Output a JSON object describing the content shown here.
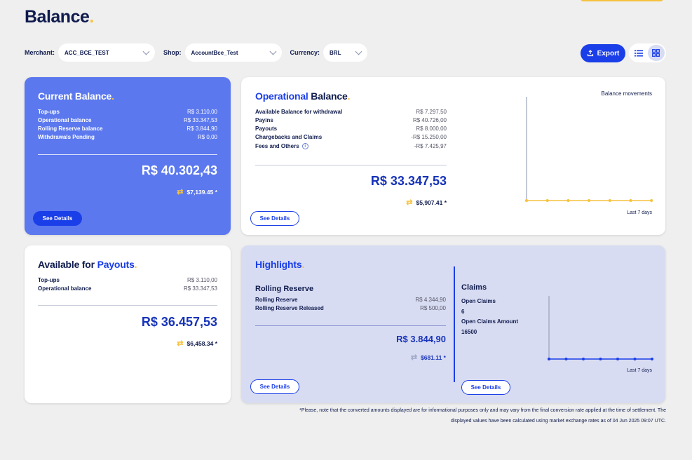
{
  "page": {
    "title": "Balance",
    "title_dot": "."
  },
  "filters": {
    "merchant_label": "Merchant:",
    "merchant_value": "ACC_BCE_TEST",
    "shop_label": "Shop:",
    "shop_value": "AccountBce_Test",
    "currency_label": "Currency:",
    "currency_value": "BRL"
  },
  "toolbar": {
    "export_label": "Export",
    "view_active": "grid"
  },
  "current_balance": {
    "title": "Current Balance",
    "rows": [
      {
        "label": "Top-ups",
        "value": "R$ 3.110,00"
      },
      {
        "label": "Operational balance",
        "value": "R$ 33.347,53"
      },
      {
        "label": "Rolling Reserve balance",
        "value": "R$ 3.844,90"
      },
      {
        "label": "Withdrawals Pending",
        "value": "R$ 0,00"
      }
    ],
    "total": "R$ 40.302,43",
    "converted": "$7,139.45 *",
    "button": "See Details"
  },
  "operational_balance": {
    "title_a": "Operational",
    "title_b": " Balance",
    "rows": [
      {
        "label": "Available Balance for withdrawal",
        "value": "R$ 7.297,50"
      },
      {
        "label": "Payins",
        "value": "R$ 40.726,00"
      },
      {
        "label": "Payouts",
        "value": "R$ 8.000,00"
      },
      {
        "label": "Chargebacks and Claims",
        "value": "-R$ 15.250,00"
      },
      {
        "label": "Fees and Others",
        "value": "-R$ 7.425,97"
      }
    ],
    "total": "R$ 33.347,53",
    "converted": "$5,907.41 *",
    "button": "See Details",
    "chart": {
      "title": "Balance movements",
      "footer": "Last 7 days"
    }
  },
  "available_payouts": {
    "title_a": "Available for ",
    "title_b": "Payouts",
    "rows": [
      {
        "label": "Top-ups",
        "value": "R$ 3.110,00"
      },
      {
        "label": "Operational balance",
        "value": "R$ 33.347,53"
      }
    ],
    "total": "R$ 36.457,53",
    "converted": "$6,458.34 *"
  },
  "highlights": {
    "title": "Highlights",
    "rolling_title": "Rolling Reserve",
    "rows": [
      {
        "label": "Rolling Reserve",
        "value": "R$ 4.344,90"
      },
      {
        "label": "Rolling Reserve Released",
        "value": "R$ 500,00"
      }
    ],
    "total": "R$ 3.844,90",
    "converted": "$681.11 *",
    "button": "See Details",
    "claims": {
      "title": "Claims",
      "open_label": "Open Claims",
      "open_value": "6",
      "amount_label": "Open Claims Amount",
      "amount_value": "16500",
      "button": "See Details",
      "footer": "Last 7 days"
    }
  },
  "footnote": {
    "line1": "*Please, note that the converted amounts displayed are for informational purposes only and may vary from the final conversion rate applied at the time of settlement. The",
    "line2": "displayed values have been calculated using market exchange rates as of 04 Jun 2025 09:07 UTC."
  },
  "chart_data": [
    {
      "type": "line",
      "name": "Balance movements",
      "points": 7,
      "color": "#f6c23e"
    },
    {
      "type": "line",
      "name": "Claims",
      "points": 7,
      "color": "#1a3ee8"
    }
  ]
}
